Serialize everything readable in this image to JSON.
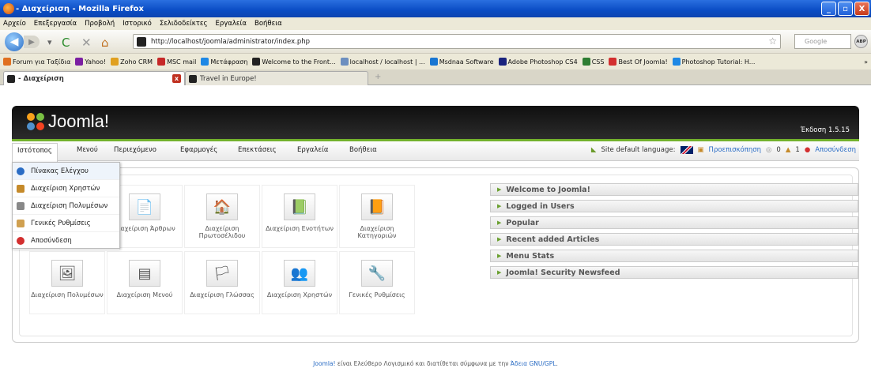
{
  "window": {
    "title": "- Διαχείριση - Mozilla Firefox",
    "controls": [
      "_",
      "▫",
      "X"
    ]
  },
  "browser_menu": [
    "Αρχείο",
    "Επεξεργασία",
    "Προβολή",
    "Ιστορικό",
    "Σελιδοδείκτες",
    "Εργαλεία",
    "Βοήθεια"
  ],
  "navbar": {
    "url": "http://localhost/joomla/administrator/index.php",
    "search_placeholder": "Google",
    "abp_label": "ABP"
  },
  "bookmarks": [
    {
      "label": "Forum για Ταξίδια",
      "color": "#e07020"
    },
    {
      "label": "Yahoo!",
      "color": "#7b1fa2"
    },
    {
      "label": "Zoho CRM",
      "color": "#e0a020"
    },
    {
      "label": "MSC mail",
      "color": "#c62828"
    },
    {
      "label": "Μετάφραση",
      "color": "#1e88e5"
    },
    {
      "label": "Welcome to the Front...",
      "color": "#222222"
    },
    {
      "label": "localhost / localhost | ...",
      "color": "#6d8fbf"
    },
    {
      "label": "Msdnaa Software",
      "color": "#1976d2"
    },
    {
      "label": "Adobe Photoshop CS4",
      "color": "#1a237e"
    },
    {
      "label": "CSS",
      "color": "#2e7d32"
    },
    {
      "label": "Best Of Joomla!",
      "color": "#d32f2f"
    },
    {
      "label": "Photoshop Tutorial: H...",
      "color": "#1e88e5"
    }
  ],
  "bookmarks_overflow": "»",
  "tabs": [
    {
      "label": "- Διαχείριση"
    },
    {
      "label": "Travel in Europe!"
    }
  ],
  "joomla": {
    "logo_text": "Joomla!",
    "version": "Έκδοση 1.5.15",
    "menu": [
      "Ιστότοπος",
      "Μενού",
      "Περιεχόμενο",
      "Εφαρμογές",
      "Επεκτάσεις",
      "Εργαλεία",
      "Βοήθεια"
    ],
    "status": {
      "language_label": "Site default language:",
      "preview": "Προεπισκόπηση",
      "messages": "0",
      "users": "1",
      "logout": "Αποσύνδεση"
    },
    "dropdown": [
      {
        "label": "Πίνακας Ελέγχου",
        "icon": "control-panel-icon"
      },
      {
        "label": "Διαχείριση Χρηστών",
        "icon": "users-icon"
      },
      {
        "label": "Διαχείριση Πολυμέσων",
        "icon": "media-icon"
      },
      {
        "label": "Γενικές Ρυθμίσεις",
        "icon": "config-icon"
      },
      {
        "label": "Αποσύνδεση",
        "icon": "logout-icon"
      }
    ],
    "icons": [
      {
        "label": "Διαχείριση Άρθρων",
        "glyph": "📄"
      },
      {
        "label": "Διαχείριση Πρωτοσέλιδου",
        "glyph": "🏠"
      },
      {
        "label": "Διαχείριση Ενοτήτων",
        "glyph": "📗"
      },
      {
        "label": "Διαχείριση Κατηγοριών",
        "glyph": "📙"
      },
      {
        "label": "Διαχείριση Πολυμέσων",
        "glyph": "🖼"
      },
      {
        "label": "Διαχείριση Μενού",
        "glyph": "▤"
      },
      {
        "label": "Διαχείριση Γλώσσας",
        "glyph": "🏳"
      },
      {
        "label": "Διαχείριση Χρηστών",
        "glyph": "👥"
      },
      {
        "label": "Γενικές Ρυθμίσεις",
        "glyph": "🔧"
      }
    ],
    "panels": [
      "Welcome to Joomla!",
      "Logged in Users",
      "Popular",
      "Recent added Articles",
      "Menu Stats",
      "Joomla! Security Newsfeed"
    ],
    "footer": {
      "link1": "Joomla!",
      "text": " είναι Ελεύθερο Λογισμικό και διατίθεται σύμφωνα με την ",
      "link2": "Άδεια GNU/GPL",
      "end": "."
    }
  }
}
